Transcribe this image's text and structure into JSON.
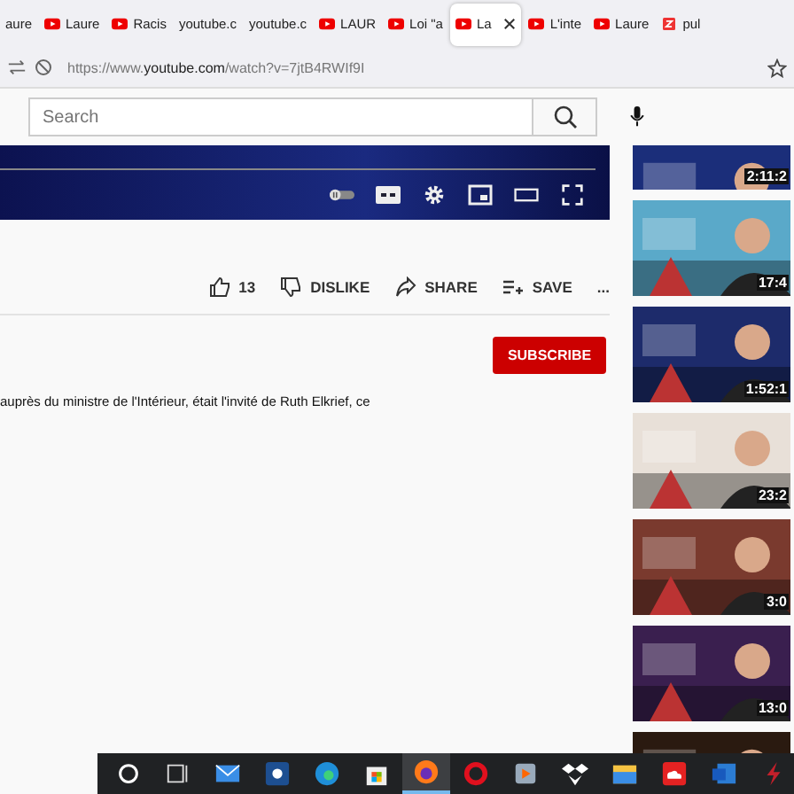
{
  "tabs": [
    {
      "label": "aure",
      "kind": "plain",
      "selected": false
    },
    {
      "label": "Laure",
      "kind": "youtube",
      "selected": false
    },
    {
      "label": "Racis",
      "kind": "youtube",
      "selected": false
    },
    {
      "label": "youtube.c",
      "kind": "plain",
      "selected": false
    },
    {
      "label": "youtube.c",
      "kind": "plain",
      "selected": false
    },
    {
      "label": "LAUR",
      "kind": "youtube",
      "selected": false
    },
    {
      "label": "Loi \"a",
      "kind": "youtube",
      "selected": false
    },
    {
      "label": "La",
      "kind": "youtube",
      "selected": true
    },
    {
      "label": "L'inte",
      "kind": "youtube",
      "selected": false
    },
    {
      "label": "Laure",
      "kind": "youtube",
      "selected": false
    },
    {
      "label": "pul",
      "kind": "z",
      "selected": false
    }
  ],
  "address": {
    "prefix": "https://www.",
    "domain": "youtube.com",
    "path": "/watch?v=7jtB4RWIf9I"
  },
  "search": {
    "placeholder": "Search"
  },
  "actions": [
    {
      "kind": "like",
      "label": "13"
    },
    {
      "kind": "dislike",
      "label": "DISLIKE"
    },
    {
      "kind": "share",
      "label": "SHARE"
    },
    {
      "kind": "save",
      "label": "SAVE"
    },
    {
      "kind": "more",
      "label": "..."
    }
  ],
  "subscribe": "SUBSCRIBE",
  "description": "auprès du ministre de l'Intérieur, était l'invité de Ruth Elkrief, ce",
  "thumbnails": [
    {
      "duration": "2:11:2"
    },
    {
      "duration": "17:4"
    },
    {
      "duration": "1:52:1"
    },
    {
      "duration": "23:2"
    },
    {
      "duration": "3:0"
    },
    {
      "duration": "13:0"
    },
    {
      "kind": "picture"
    }
  ],
  "taskbar": [
    {
      "kind": "search",
      "active": false
    },
    {
      "kind": "taskview",
      "active": false
    },
    {
      "kind": "mail",
      "active": false
    },
    {
      "kind": "b",
      "active": false
    },
    {
      "kind": "edge",
      "active": false
    },
    {
      "kind": "store",
      "active": false
    },
    {
      "kind": "firefox",
      "active": true
    },
    {
      "kind": "opera",
      "active": false
    },
    {
      "kind": "media",
      "active": false
    },
    {
      "kind": "dropbox",
      "active": false
    },
    {
      "kind": "folder",
      "active": false
    },
    {
      "kind": "cloud",
      "active": false
    },
    {
      "kind": "word",
      "active": false
    },
    {
      "kind": "bolt",
      "active": false
    }
  ]
}
